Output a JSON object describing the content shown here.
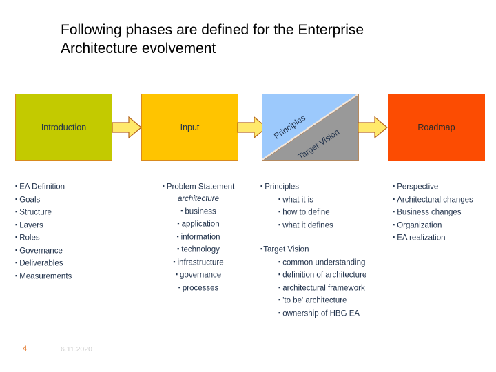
{
  "slide": {
    "title": "Following phases are defined for the Enterprise\nArchitecture evolvement",
    "page_number": "4",
    "date": "6.11.2020"
  },
  "colors": {
    "introduction_box": "#c3ca00",
    "input_box": "#ffc400",
    "principles_half": "#9cc9fc",
    "target_vision_half": "#999999",
    "roadmap_box": "#fc4c02",
    "arrow_fill": "#ffe96b",
    "arrow_stroke": "#b5651d",
    "page_number": "#e06c1a",
    "date": "#cfcfcf"
  },
  "flow": {
    "phases": [
      {
        "label": "Introduction"
      },
      {
        "label": "Input"
      },
      {
        "label_upper": "Principles",
        "label_lower": "Target Vision"
      },
      {
        "label": "Roadmap"
      }
    ],
    "arrows": [
      {
        "name": "arrow-introduction-to-input"
      },
      {
        "name": "arrow-input-to-principles"
      },
      {
        "name": "arrow-principles-to-roadmap"
      }
    ]
  },
  "columns": [
    {
      "name": "introduction-details",
      "items": [
        {
          "text": "EA Definition",
          "level": 1,
          "bullet": true
        },
        {
          "text": "Goals",
          "level": 1,
          "bullet": true
        },
        {
          "text": "Structure",
          "level": 1,
          "bullet": true
        },
        {
          "text": "Layers",
          "level": 1,
          "bullet": true
        },
        {
          "text": "Roles",
          "level": 1,
          "bullet": true
        },
        {
          "text": "Governance",
          "level": 1,
          "bullet": true
        },
        {
          "text": "Deliverables",
          "level": 1,
          "bullet": true
        },
        {
          "text": "Measurements",
          "level": 1,
          "bullet": true
        }
      ]
    },
    {
      "name": "input-details",
      "items": [
        {
          "text": "Problem Statement",
          "level": 1,
          "bullet": true
        },
        {
          "text": "architecture",
          "level": 2,
          "bullet": false,
          "italic": true
        },
        {
          "text": "business",
          "level": 2,
          "bullet": true
        },
        {
          "text": "application",
          "level": 2,
          "bullet": true
        },
        {
          "text": "information",
          "level": 2,
          "bullet": true
        },
        {
          "text": "technology",
          "level": 2,
          "bullet": true
        },
        {
          "text": "infrastructure",
          "level": 2,
          "bullet": true
        },
        {
          "text": "governance",
          "level": 2,
          "bullet": true
        },
        {
          "text": "processes",
          "level": 2,
          "bullet": true
        }
      ]
    },
    {
      "name": "principles-target-vision-details",
      "items": [
        {
          "text": "Principles",
          "level": 1,
          "bullet": true
        },
        {
          "text": "what it is",
          "level": 2,
          "bullet": true
        },
        {
          "text": "how to define",
          "level": 2,
          "bullet": true
        },
        {
          "text": "what it defines",
          "level": 2,
          "bullet": true
        },
        {
          "text": "",
          "level": 0,
          "bullet": false,
          "spacer": true
        },
        {
          "text": "Target Vision",
          "level": 1,
          "bullet": true,
          "tight": true
        },
        {
          "text": "common understanding",
          "level": 2,
          "bullet": true
        },
        {
          "text": "definition of architecture",
          "level": 2,
          "bullet": true
        },
        {
          "text": "architectural framework",
          "level": 2,
          "bullet": true
        },
        {
          "text": "'to be' architecture",
          "level": 2,
          "bullet": true
        },
        {
          "text": "ownership of HBG EA",
          "level": 2,
          "bullet": true
        }
      ]
    },
    {
      "name": "roadmap-details",
      "items": [
        {
          "text": "Perspective",
          "level": 1,
          "bullet": true
        },
        {
          "text": "Architectural changes",
          "level": 1,
          "bullet": true
        },
        {
          "text": "Business changes",
          "level": 1,
          "bullet": true
        },
        {
          "text": "Organization",
          "level": 1,
          "bullet": true
        },
        {
          "text": "EA realization",
          "level": 1,
          "bullet": true
        }
      ]
    }
  ]
}
